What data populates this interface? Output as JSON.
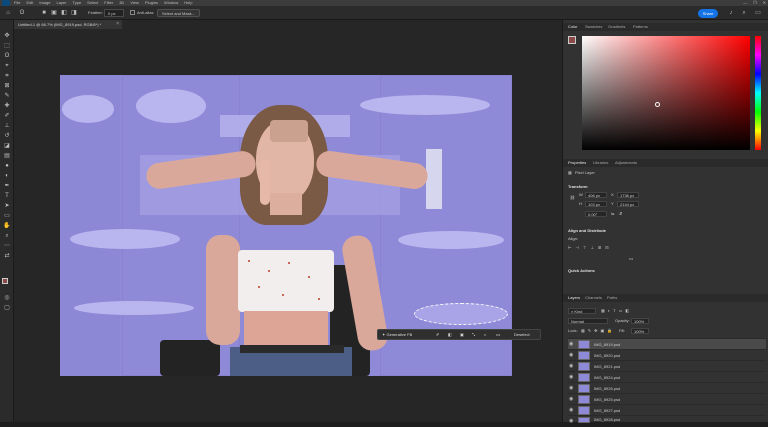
{
  "menubar": {
    "items": [
      "File",
      "Edit",
      "Image",
      "Layer",
      "Type",
      "Select",
      "Filter",
      "3D",
      "View",
      "Plugins",
      "Window",
      "Help"
    ],
    "window_controls": [
      "—",
      "❐",
      "✕"
    ]
  },
  "options_bar": {
    "feather_label": "Feather:",
    "feather_value": "0 px",
    "anti_alias_label": "Anti-alias",
    "select_mask_label": "Select and Mask...",
    "share_label": "Share"
  },
  "document": {
    "tab_title": "Untitled-1 @ 66.7% (IMG_8919.psd, RGB/8*) *",
    "close_glyph": "×"
  },
  "contextual_bar": {
    "generative_fill": "Generative Fill",
    "more": "•••",
    "deselect": "Deselect"
  },
  "color_panel": {
    "tabs": [
      "Color",
      "Swatches",
      "Gradients",
      "Patterns"
    ],
    "foreground_color": "#8a4a47"
  },
  "properties_panel": {
    "tabs": [
      "Properties",
      "Libraries",
      "Adjustments"
    ],
    "layer_type": "Pixel Layer",
    "transform_title": "Transform",
    "w_label": "W",
    "w_value": "406 px",
    "h_label": "H",
    "h_value": "103 px",
    "x_label": "X",
    "x_value": "1736 px",
    "y_label": "Y",
    "y_value": "2144 px",
    "angle_value": "0.00°",
    "align_title": "Align and Distribute",
    "align_label": "Align:",
    "more_dots": "•••",
    "quick_actions_title": "Quick Actions"
  },
  "layers_panel": {
    "tabs": [
      "Layers",
      "Channels",
      "Paths"
    ],
    "kind_label": "Kind",
    "blend_mode": "Normal",
    "opacity_label": "Opacity:",
    "opacity_value": "100%",
    "lock_label": "Lock:",
    "fill_label": "Fill:",
    "fill_value": "100%",
    "layers": [
      {
        "name": "IMG_8919.psd",
        "selected": true
      },
      {
        "name": "IMG_8920.psd",
        "selected": false
      },
      {
        "name": "IMG_8921.psd",
        "selected": false
      },
      {
        "name": "IMG_8924.psd",
        "selected": false
      },
      {
        "name": "IMG_8926.psd",
        "selected": false
      },
      {
        "name": "IMG_8925.psd",
        "selected": false
      },
      {
        "name": "IMG_8927.psd",
        "selected": false
      },
      {
        "name": "IMG_8928.psd",
        "selected": false
      }
    ]
  }
}
